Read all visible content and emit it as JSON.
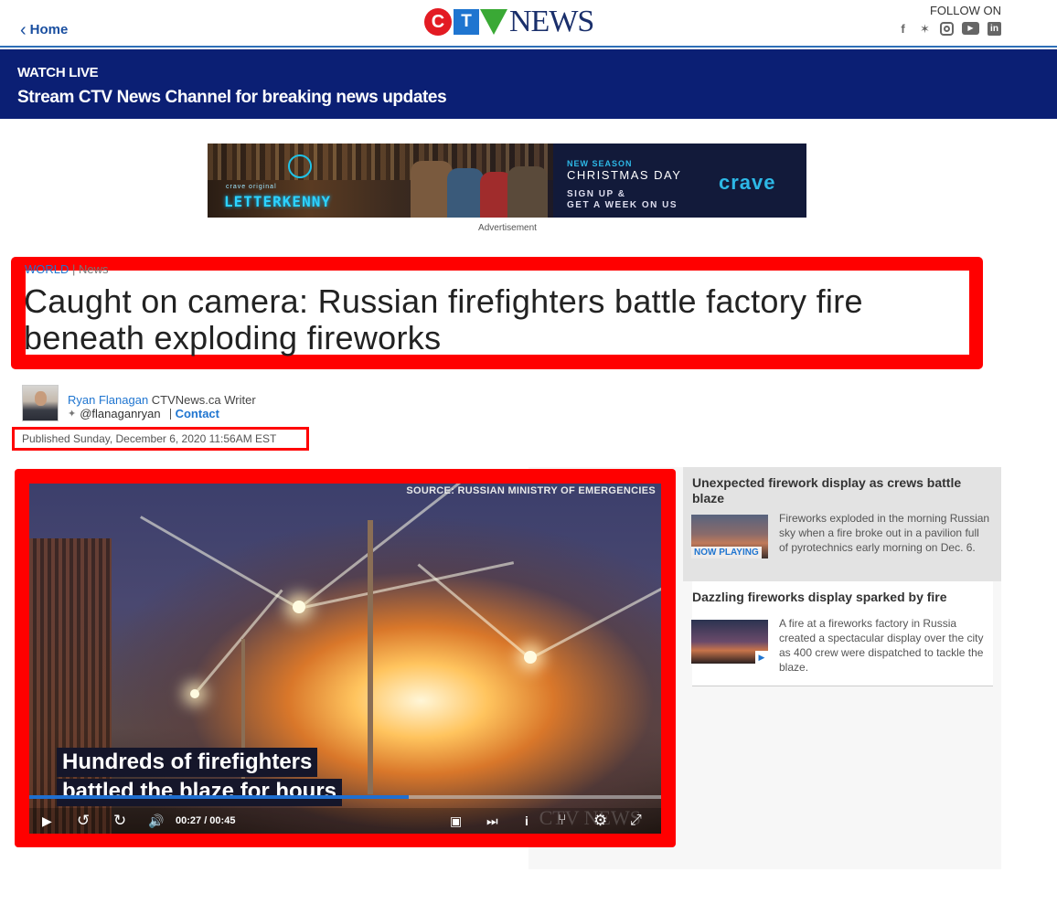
{
  "header": {
    "home_label": "Home",
    "logo": {
      "c": "C",
      "t": "T",
      "news": "NEWS"
    },
    "follow_label": "FOLLOW ON",
    "social_icons": [
      "facebook-icon",
      "twitter-icon",
      "instagram-icon",
      "youtube-icon",
      "linkedin-icon"
    ],
    "social_glyphs": {
      "facebook": "f",
      "twitter": "✶",
      "youtube": "▶",
      "linkedin": "in"
    }
  },
  "watch_live": {
    "label": "WATCH LIVE",
    "text": "Stream CTV News Channel for breaking news updates"
  },
  "ad": {
    "brand_original": "crave original",
    "show": "LETTERKENNY",
    "new_season": "NEW SEASON",
    "date": "CHRISTMAS DAY",
    "cta_line1": "SIGN UP &",
    "cta_line2": "GET A WEEK ON US",
    "logo": "crave",
    "label": "Advertisement"
  },
  "article": {
    "category": "WORLD",
    "subcategory": "News",
    "headline": "Caught on camera: Russian firefighters battle factory fire beneath exploding fireworks",
    "author_name": "Ryan Flanagan",
    "author_role": "CTVNews.ca Writer",
    "twitter_handle": "@flanaganryan",
    "contact_label": "Contact",
    "published": "Published Sunday, December 6, 2020 11:56AM EST"
  },
  "video": {
    "source": "SOURCE:  RUSSIAN MINISTRY OF EMERGENCIES",
    "caption_line1": "Hundreds of firefighters",
    "caption_line2": "battled the blaze for hours",
    "watermark": "CTV NEWS",
    "current_time": "00:27",
    "duration": "00:45",
    "time_display": "00:27  /  00:45",
    "progress": 0.6,
    "controls": {
      "play": "▶",
      "rewind": "↺",
      "forward": "↻",
      "volume": "🔊",
      "playlist": "▣",
      "next": "⏭",
      "info": "i",
      "share": "⑂",
      "settings": "⚙",
      "fullscreen": "⤢"
    }
  },
  "sidebar": {
    "items": [
      {
        "title": "Unexpected firework display as crews battle blaze",
        "description": "Fireworks exploded in the morning Russian sky when a fire broke out in a pavilion full of pyrotechnics early morning on Dec. 6.",
        "badge": "NOW PLAYING"
      },
      {
        "title": "Dazzling fireworks display sparked by fire",
        "description": "A fire at a fireworks factory in Russia created a spectacular display over the city as 400 crew were dispatched to tackle the blaze.",
        "badge": "▶"
      }
    ]
  }
}
